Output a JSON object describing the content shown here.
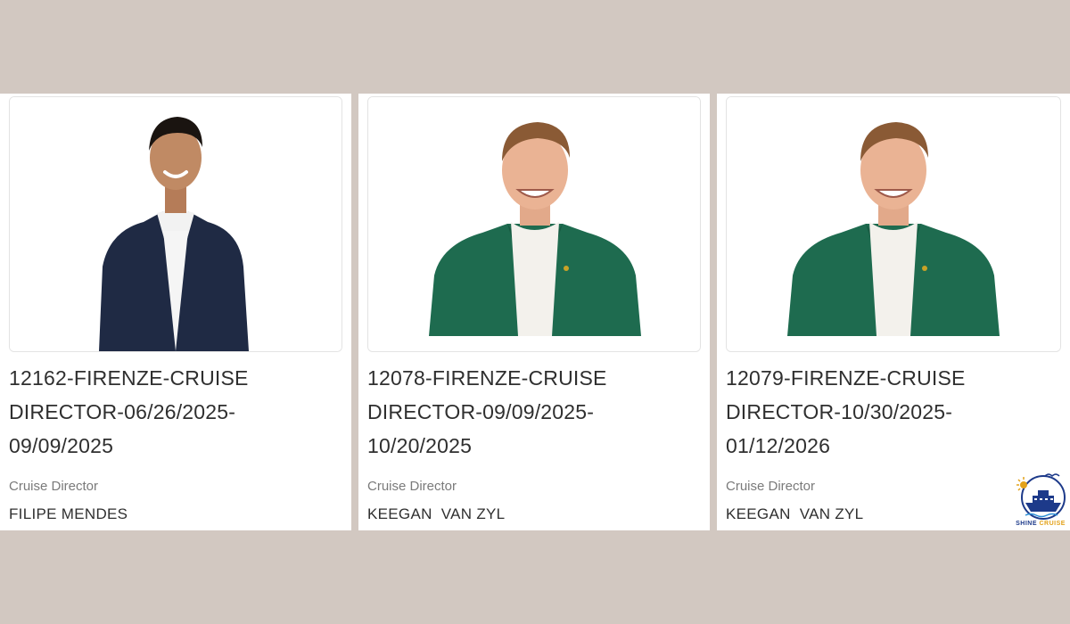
{
  "colors": {
    "page_background": "#d2c8c1",
    "card_background": "#ffffff",
    "jacket_navy": "#1f2a44",
    "jacket_green": "#1e6b4f",
    "logo_blue": "#1d3a8a",
    "logo_gold": "#e3a21a"
  },
  "cards": [
    {
      "photo_icon": "portrait-man-navy-jacket",
      "title_line1": "12162-FIRENZE-CRUISE",
      "title_line2": "DIRECTOR-06/26/2025-",
      "title_line3": "09/09/2025",
      "role": "Cruise Director",
      "name": "FILIPE MENDES"
    },
    {
      "photo_icon": "portrait-man-green-jacket",
      "title_line1": "12078-FIRENZE-CRUISE",
      "title_line2": "DIRECTOR-09/09/2025-",
      "title_line3": "10/20/2025",
      "role": "Cruise Director",
      "name": "KEEGAN  VAN ZYL"
    },
    {
      "photo_icon": "portrait-man-green-jacket",
      "title_line1": "12079-FIRENZE-CRUISE",
      "title_line2": "DIRECTOR-10/30/2025-",
      "title_line3": "01/12/2026",
      "role": "Cruise Director",
      "name": "KEEGAN  VAN ZYL"
    }
  ],
  "logo": {
    "icon": "cruise-ship-sun-logo",
    "word1": "SHINE",
    "word2": "CRUISE"
  }
}
